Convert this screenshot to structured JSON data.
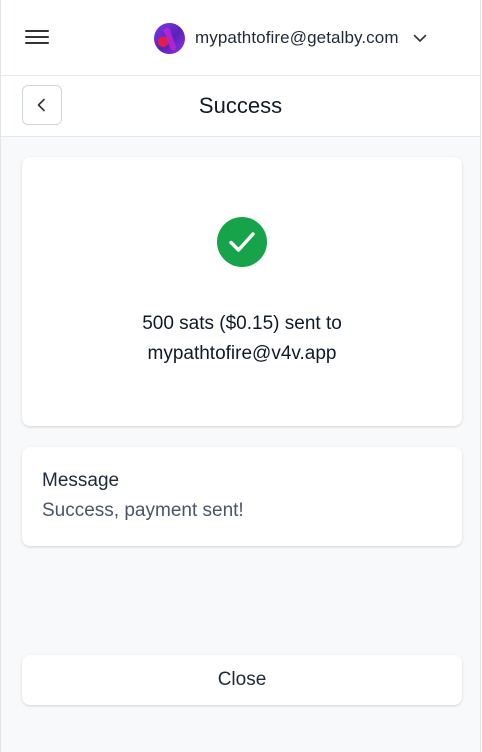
{
  "account": {
    "email": "mypathtofire@getalby.com",
    "avatar_icon": "avatar-icon"
  },
  "header": {
    "title": "Success",
    "back_icon": "chevron-left-icon",
    "menu_icon": "hamburger-menu-icon"
  },
  "result": {
    "status_icon": "check-circle-icon",
    "amount_line": "500 sats ($0.15) sent to",
    "recipient": "mypathtofire@v4v.app"
  },
  "message": {
    "label": "Message",
    "value": "Success, payment sent!"
  },
  "actions": {
    "close_label": "Close"
  },
  "colors": {
    "success_green": "#16a34a",
    "background": "#f8f9fb",
    "card": "#ffffff",
    "text": "#111827"
  }
}
